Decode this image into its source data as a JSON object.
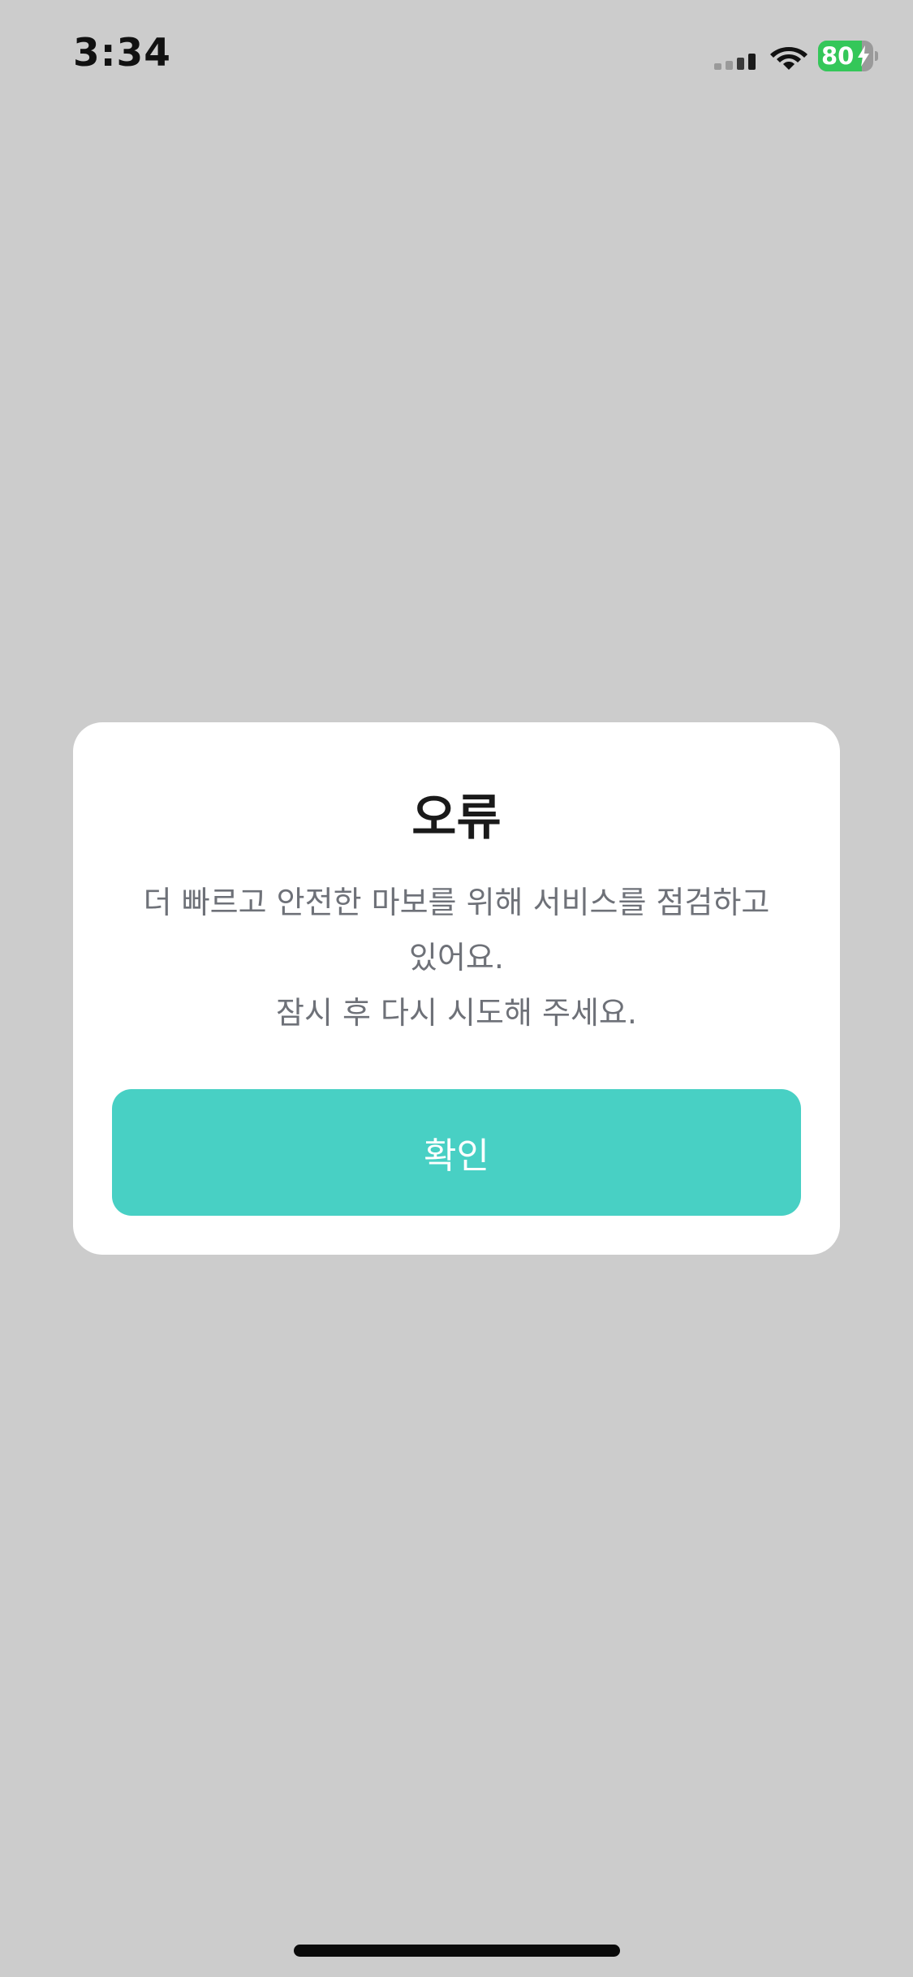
{
  "status_bar": {
    "time": "3:34",
    "battery_level": "80",
    "battery_fraction": 0.8,
    "charging": true,
    "signal_bars_active": 2,
    "signal_bars_total": 4
  },
  "dialog": {
    "title": "오류",
    "message": "더 빠르고 안전한 마보를 위해 서비스를 점검하고\n있어요.\n잠시 후 다시 시도해 주세요.",
    "confirm_label": "확인"
  },
  "colors": {
    "background": "#cccccc",
    "accent": "#48d0c4",
    "battery_green": "#34c759",
    "text_primary": "#1a1a1a",
    "text_secondary": "#6e7178"
  },
  "icons": {
    "signal": "cellular-signal-icon",
    "wifi": "wifi-icon",
    "battery": "battery-charging-icon"
  }
}
